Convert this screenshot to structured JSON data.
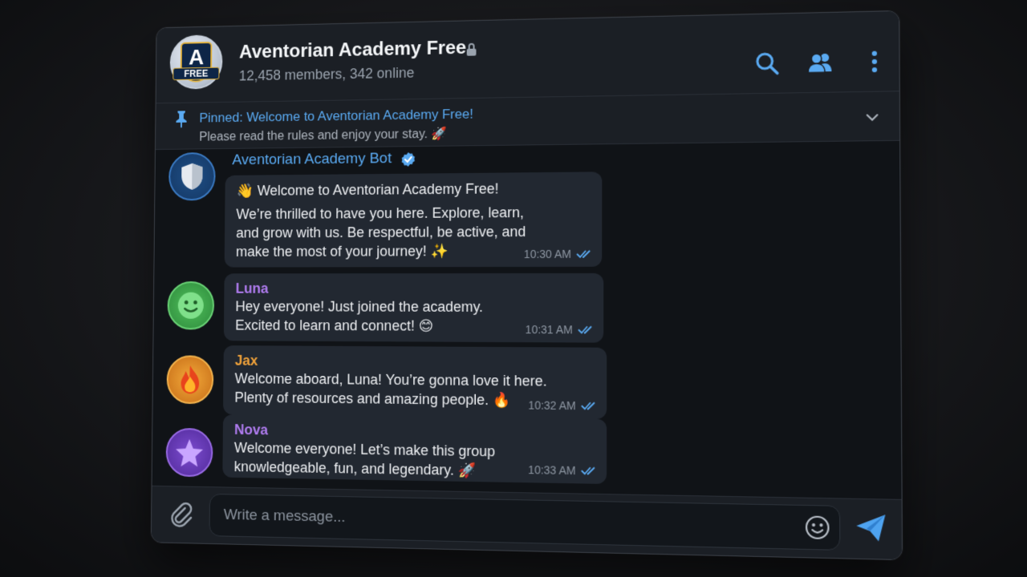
{
  "header": {
    "title": "Aventorian Academy Free",
    "subtitle": "12,458 members, 342 online",
    "logo_letter": "A",
    "logo_badge": "FREE",
    "icons": [
      "lock-icon",
      "search-icon",
      "members-icon",
      "more-vertical-icon"
    ]
  },
  "pinned": {
    "title": "Pinned: Welcome to Aventorian Academy Free!",
    "text": "Please read the rules and enjoy your stay. 🚀",
    "icons": [
      "pin-icon",
      "chevron-down-icon"
    ]
  },
  "messages": [
    {
      "sender": "Aventorian Academy Bot",
      "verified": true,
      "header_line": "👋 Welcome to Aventorian Academy Free!",
      "lines": [
        "We’re thrilled to have you here. Explore, learn,",
        "and grow with us. Be respectful, be active, and",
        "make the most of your journey! ✨"
      ],
      "time": "10:30 AM",
      "avatar_icon": "shield-icon"
    },
    {
      "sender": "Luna",
      "lines": [
        "Hey everyone! Just joined the academy.",
        "Excited to learn and connect! 😊"
      ],
      "time": "10:31 AM",
      "avatar_icon": "smiley-icon"
    },
    {
      "sender": "Jax",
      "lines": [
        "Welcome aboard, Luna! You’re gonna love it here.",
        "Plenty of resources and amazing people. 🔥"
      ],
      "time": "10:32 AM",
      "avatar_icon": "fire-icon"
    },
    {
      "sender": "Nova",
      "lines": [
        "Welcome everyone! Let’s make this group",
        "knowledgeable, fun, and legendary. 🚀"
      ],
      "time": "10:33 AM",
      "avatar_icon": "star-icon"
    }
  ],
  "composer": {
    "placeholder": "Write a message...",
    "icons": [
      "paperclip-icon",
      "emoji-icon",
      "send-icon"
    ]
  },
  "colors": {
    "accent": "#5aaaf2",
    "luna": "#b07cf0",
    "jax": "#f0a23a",
    "nova": "#b07cf0",
    "bubble": "#222831"
  }
}
